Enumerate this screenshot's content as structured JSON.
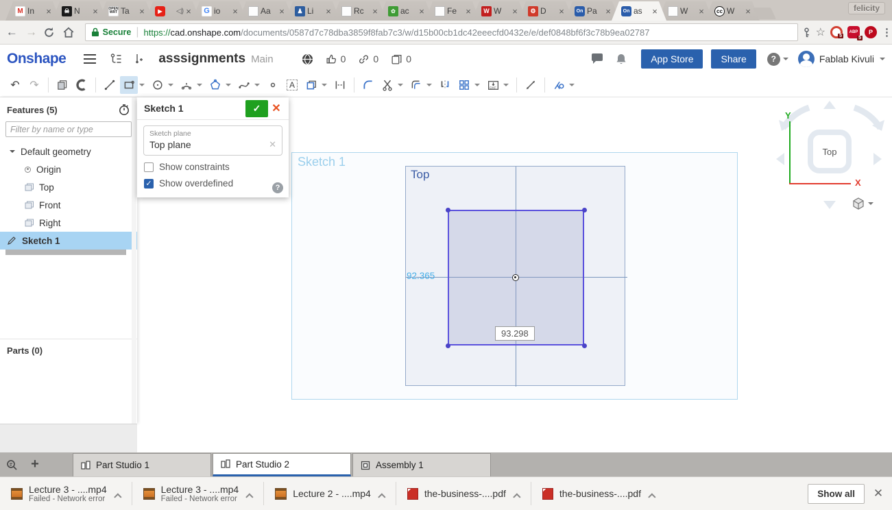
{
  "colors": {
    "accent_blue": "#2a61ad",
    "logo_blue": "#2b54c0",
    "selection_blue": "#a8d4f3",
    "sketch_purple": "#5a51dd",
    "dim_lightblue": "#49b0e8",
    "secure_green": "#188038",
    "confirm_green": "#1fa01f",
    "cancel_red": "#e8501f"
  },
  "browser": {
    "system_label": "felicity",
    "tabs": [
      {
        "icon": "gmail-favicon",
        "label": "In"
      },
      {
        "icon": "skull-favicon",
        "label": "N"
      },
      {
        "icon": "openwrt-favicon",
        "label": "Ta"
      },
      {
        "icon": "youtube-favicon",
        "label": ""
      },
      {
        "icon": "google-favicon",
        "label": "io"
      },
      {
        "icon": "document-favicon",
        "label": "Aa"
      },
      {
        "icon": "library-favicon",
        "label": "Li"
      },
      {
        "icon": "document-favicon",
        "label": "Rc"
      },
      {
        "icon": "green-app-favicon",
        "label": "ac"
      },
      {
        "icon": "document-favicon",
        "label": "Fe"
      },
      {
        "icon": "red-w-favicon",
        "label": "W"
      },
      {
        "icon": "red-gear-favicon",
        "label": "D"
      },
      {
        "icon": "onshape-favicon",
        "label": "Pa"
      },
      {
        "icon": "onshape-favicon",
        "label": "as",
        "active": true
      },
      {
        "icon": "document-favicon",
        "label": "W"
      },
      {
        "icon": "cc-favicon",
        "label": "W"
      }
    ],
    "nav": {
      "secure_label": "Secure",
      "url_scheme": "https://",
      "url_domain": "cad.onshape.com",
      "url_path": "/documents/0587d7c78dba3859f8fab7c3/w/d15b00cb1dc42eeecfd0432e/e/def0848bf6f3c78b9ea02787"
    },
    "extensions": [
      {
        "name": "onetab",
        "badge": "5"
      },
      {
        "name": "adblock",
        "label": "ABP",
        "badge": "5"
      },
      {
        "name": "pinterest",
        "label": "P"
      }
    ]
  },
  "header": {
    "logo": "Onshape",
    "title": "asssignments",
    "workspace": "Main",
    "like_count": "0",
    "link_count": "0",
    "copy_count": "0",
    "app_store_label": "App Store",
    "share_label": "Share",
    "user_name": "Fablab Kivuli"
  },
  "toolbar": {
    "items": [
      "undo",
      "redo",
      "extrude",
      "revolve",
      "line",
      "rectangle",
      "circle",
      "arc",
      "polygon",
      "spline",
      "point",
      "text",
      "use-convert",
      "dimension",
      "fillet",
      "trim",
      "offset",
      "mirror",
      "pattern",
      "export-dxf",
      "measure",
      "constraint"
    ],
    "active_item": "rectangle"
  },
  "features_panel": {
    "title": "Features (5)",
    "filter_placeholder": "Filter by name or type",
    "tree": [
      {
        "label": "Default geometry",
        "icon": "chevron-down-icon"
      },
      {
        "label": "Origin",
        "icon": "origin-icon"
      },
      {
        "label": "Top",
        "icon": "plane-icon"
      },
      {
        "label": "Front",
        "icon": "plane-icon"
      },
      {
        "label": "Right",
        "icon": "plane-icon"
      },
      {
        "label": "Sketch 1",
        "icon": "sketch-pencil-icon",
        "selected": true
      }
    ],
    "parts_title": "Parts (0)"
  },
  "sketch_dialog": {
    "title": "Sketch 1",
    "plane_label": "Sketch plane",
    "plane_value": "Top plane",
    "show_constraints_label": "Show constraints",
    "show_constraints_checked": false,
    "show_overdefined_label": "Show overdefined",
    "show_overdefined_checked": true
  },
  "canvas": {
    "sketch_label": "Sketch 1",
    "plane_name": "Top",
    "dim_vertical": "92.365",
    "dim_horizontal": "93.298"
  },
  "view_cube": {
    "face": "Top",
    "x_label": "X",
    "y_label": "Y"
  },
  "element_tabs": {
    "tabs": [
      {
        "label": "Part Studio 1",
        "active": false
      },
      {
        "label": "Part Studio 2",
        "active": true
      },
      {
        "label": "Assembly 1",
        "active": false
      }
    ]
  },
  "downloads": {
    "items": [
      {
        "name": "Lecture 3 - ....mp4",
        "status": "Failed - Network error",
        "type": "video"
      },
      {
        "name": "Lecture 3 - ....mp4",
        "status": "Failed - Network error",
        "type": "video"
      },
      {
        "name": "Lecture 2 - ....mp4",
        "status": "",
        "type": "video"
      },
      {
        "name": "the-business-....pdf",
        "status": "",
        "type": "pdf"
      },
      {
        "name": "the-business-....pdf",
        "status": "",
        "type": "pdf"
      }
    ],
    "show_all_label": "Show all"
  }
}
